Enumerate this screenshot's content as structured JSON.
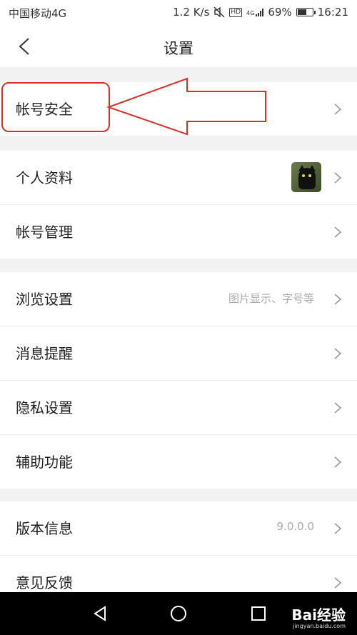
{
  "status_bar": {
    "carrier": "中国移动4G",
    "speed": "1.2 K/s",
    "hd_badge": "HD",
    "network": "4G",
    "battery_percent": "69%",
    "battery_level": 0.69,
    "time": "16:21"
  },
  "header": {
    "title": "设置",
    "back_icon": "chevron-left-icon"
  },
  "groups": [
    {
      "rows": [
        {
          "label": "帐号安全",
          "icon": "chevron-right-icon"
        }
      ]
    },
    {
      "rows": [
        {
          "label": "个人资料",
          "avatar": "black-cat-avatar",
          "icon": "chevron-right-icon"
        },
        {
          "label": "帐号管理",
          "icon": "chevron-right-icon"
        }
      ]
    },
    {
      "rows": [
        {
          "label": "浏览设置",
          "value": "图片显示、字号等",
          "icon": "chevron-right-icon"
        },
        {
          "label": "消息提醒",
          "icon": "chevron-right-icon"
        },
        {
          "label": "隐私设置",
          "icon": "chevron-right-icon"
        },
        {
          "label": "辅助功能",
          "icon": "chevron-right-icon"
        }
      ]
    },
    {
      "rows": [
        {
          "label": "版本信息",
          "value": "9.0.0.0",
          "icon": "chevron-right-icon"
        },
        {
          "label": "意见反馈",
          "icon": "chevron-right-icon"
        }
      ]
    }
  ],
  "annotation": {
    "color": "#d9302a",
    "type": "red-arrow-pointing-left"
  },
  "system_nav": {
    "back": "triangle-back-icon",
    "home": "circle-home-icon",
    "recents": "square-recents-icon",
    "watermark": "Bai经验",
    "watermark_sub": "jingyan.baidu.com"
  }
}
